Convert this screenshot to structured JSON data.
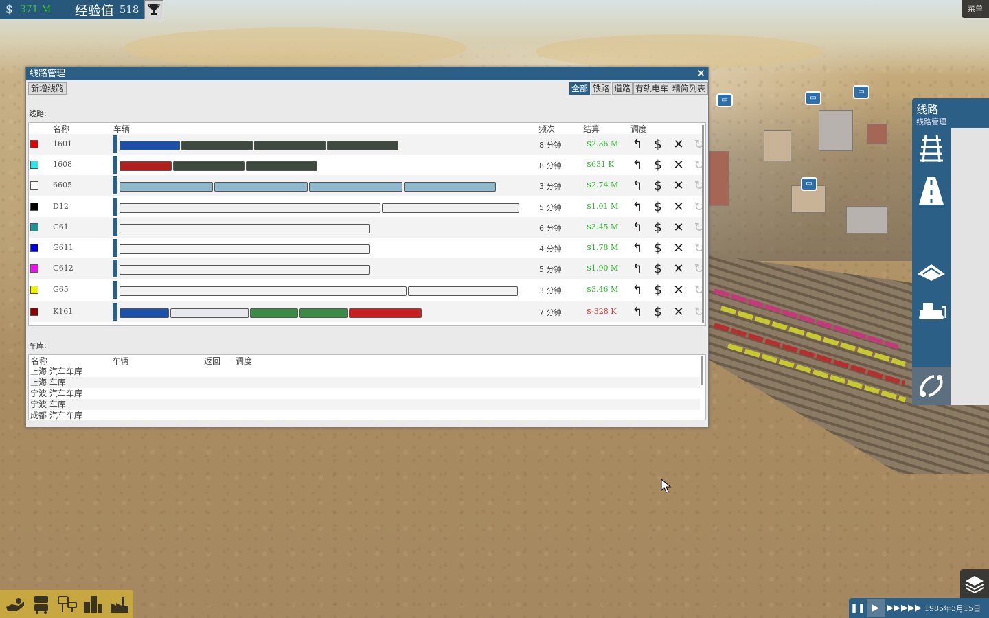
{
  "hud": {
    "currency_symbol": "$",
    "money": "371 M",
    "xp_label": "经验值",
    "xp_value": "518",
    "menu_label": "菜单"
  },
  "window": {
    "title": "线路管理",
    "add_line_label": "新增线路",
    "filter_tabs": [
      "全部",
      "铁路",
      "道路",
      "有轨电车"
    ],
    "compact_list_label": "精简列表",
    "lines_section_label": "线路:",
    "columns": {
      "name": "名称",
      "vehicles": "车辆",
      "frequency": "频次",
      "settlement": "结算",
      "dispatch": "调度"
    },
    "lines": [
      {
        "name": "1601",
        "color": "#e00000",
        "frequency": "8 分钟",
        "settlement": "$2.36 M",
        "profit": true
      },
      {
        "name": "1608",
        "color": "#2fe6e6",
        "frequency": "8 分钟",
        "settlement": "$631 K",
        "profit": true
      },
      {
        "name": "6605",
        "color": "#ffffff",
        "frequency": "3 分钟",
        "settlement": "$2.74 M",
        "profit": true
      },
      {
        "name": "D12",
        "color": "#000000",
        "frequency": "5 分钟",
        "settlement": "$1.01 M",
        "profit": true
      },
      {
        "name": "G61",
        "color": "#1a9494",
        "frequency": "6 分钟",
        "settlement": "$3.45 M",
        "profit": true
      },
      {
        "name": "G611",
        "color": "#0000dd",
        "frequency": "4 分钟",
        "settlement": "$1.78 M",
        "profit": true
      },
      {
        "name": "G612",
        "color": "#ee11ee",
        "frequency": "5 分钟",
        "settlement": "$1.90 M",
        "profit": true
      },
      {
        "name": "G65",
        "color": "#f2f200",
        "frequency": "3 分钟",
        "settlement": "$3.46 M",
        "profit": true
      },
      {
        "name": "K161",
        "color": "#8b0000",
        "frequency": "7 分钟",
        "settlement": "$-328 K",
        "profit": false
      }
    ],
    "depot_section_label": "车库:",
    "depot_columns": {
      "name": "名称",
      "vehicles": "车辆",
      "return": "返回",
      "dispatch": "调度"
    },
    "depots": [
      "上海 汽车车库",
      "上海 车库",
      "宁波 汽车车库",
      "宁波 车库",
      "成都 汽车车库"
    ]
  },
  "right_panel": {
    "title": "线路",
    "subtitle": "线路管理",
    "icons": [
      "rail-track-icon",
      "road-icon",
      "terrain-icon",
      "bulldozer-icon",
      "line-manager-icon"
    ]
  },
  "bottom_toolbar": {
    "icons": [
      "money-hand-icon",
      "vehicles-icon",
      "stations-icon",
      "towns-icon",
      "industry-icon"
    ]
  },
  "speed_bar": {
    "date": "1985年3月15日"
  },
  "colors": {
    "ui_blue": "#2b5f85",
    "profit_green": "#2eb82e",
    "loss_red": "#e03030",
    "toolbar_gold": "#c7a740"
  }
}
